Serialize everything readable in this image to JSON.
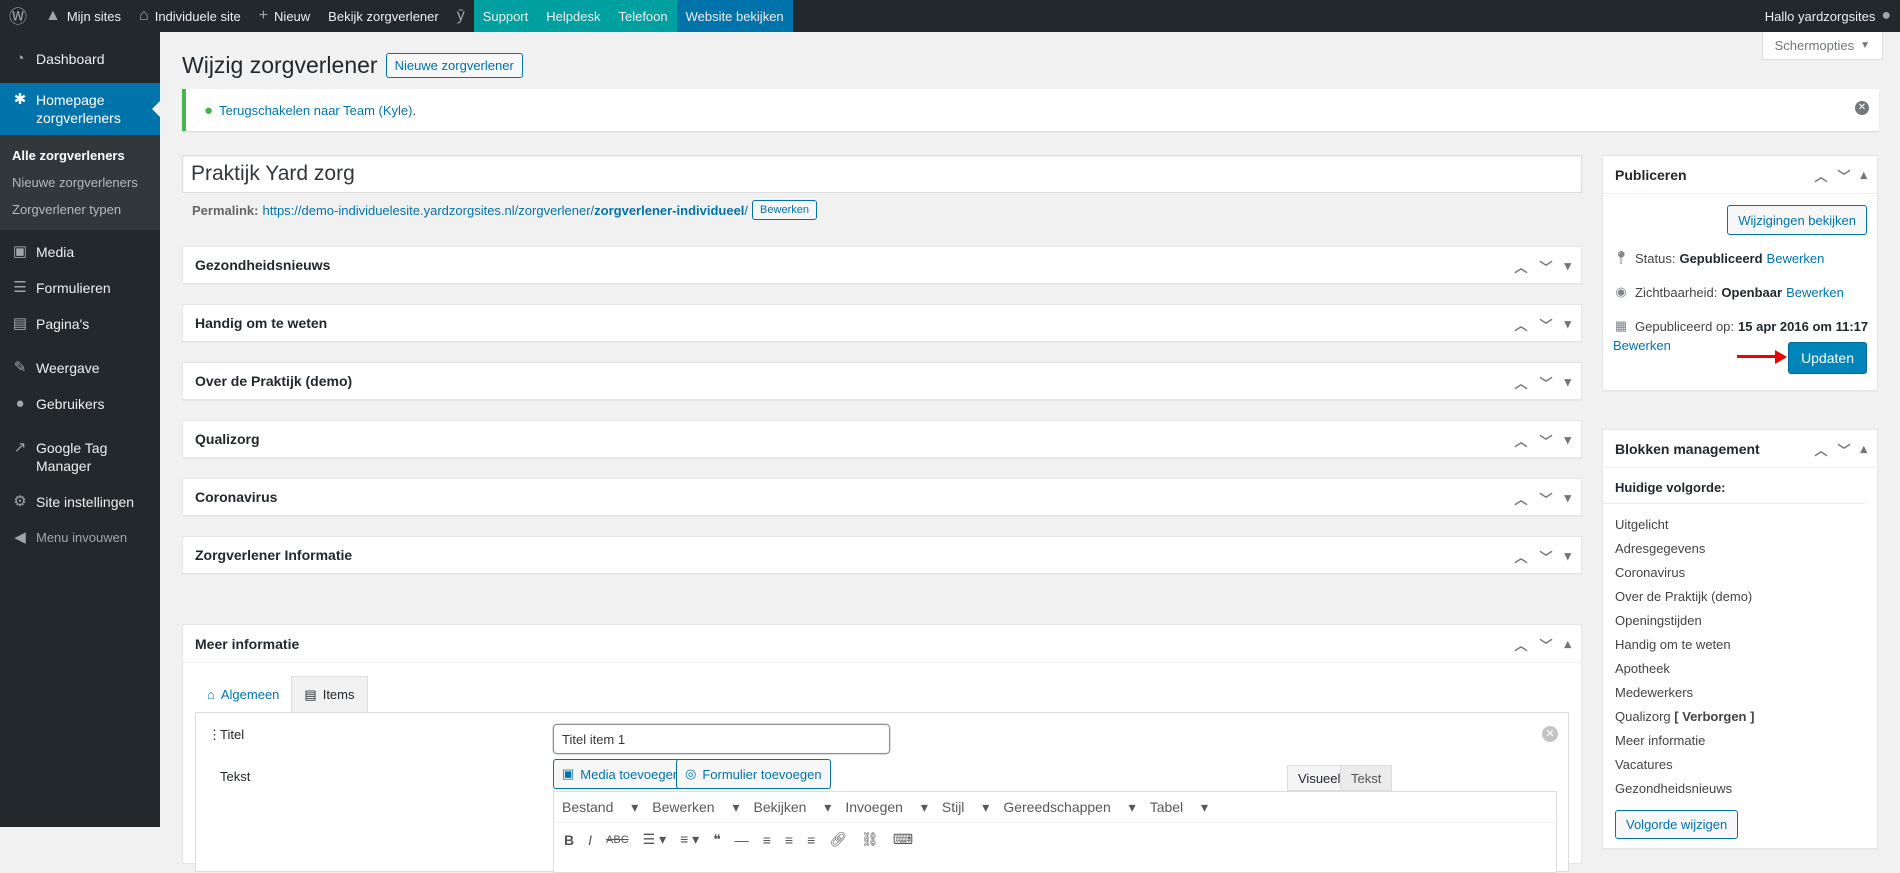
{
  "adminbar": {
    "mijn_sites": "Mijn sites",
    "individuele_site": "Individuele site",
    "nieuw": "Nieuw",
    "bekijk": "Bekijk zorgverlener",
    "support": "Support",
    "helpdesk": "Helpdesk",
    "telefoon": "Telefoon",
    "website_bekijken": "Website bekijken",
    "greeting": "Hallo yardzorgsites"
  },
  "sidebar": {
    "dashboard": "Dashboard",
    "homepage_line1": "Homepage",
    "homepage_line2": "zorgverleners",
    "sub": [
      "Alle zorgverleners",
      "Nieuwe zorgverleners",
      "Zorgverlener typen"
    ],
    "media": "Media",
    "formulieren": "Formulieren",
    "paginas": "Pagina's",
    "weergave": "Weergave",
    "gebruikers": "Gebruikers",
    "gtm_line1": "Google Tag",
    "gtm_line2": "Manager",
    "site_instellingen": "Site instellingen",
    "menu_invouwen": "Menu invouwen"
  },
  "screen_options": "Schermopties",
  "page": {
    "title": "Wijzig zorgverlener",
    "new_button": "Nieuwe zorgverlener",
    "notice_link": "Terugschakelen naar Team (Kyle)",
    "notice_suffix": ".",
    "post_title": "Praktijk Yard zorg",
    "permalink_label": "Permalink:",
    "permalink_base": "https://demo-individuelesite.yardzorgsites.nl/zorgverlener/",
    "permalink_slug": "zorgverlener-individueel",
    "permalink_tail": "/",
    "permalink_edit": "Bewerken"
  },
  "postboxes": [
    "Gezondheidsnieuws",
    "Handig om te weten",
    "Over de Praktijk (demo)",
    "Qualizorg",
    "Coronavirus",
    "Zorgverlener Informatie"
  ],
  "meer": {
    "title": "Meer informatie",
    "tab_algemeen": "Algemeen",
    "tab_items": "Items",
    "titel_label": "Titel",
    "titel_value": "Titel item 1",
    "tekst_label": "Tekst",
    "media_btn": "Media toevoegen",
    "formulier_btn": "Formulier toevoegen",
    "visueel": "Visueel",
    "tekst_tab": "Tekst",
    "menus": [
      "Bestand",
      "Bewerken",
      "Bekijken",
      "Invoegen",
      "Stijl",
      "Gereedschappen",
      "Tabel"
    ]
  },
  "publish": {
    "title": "Publiceren",
    "preview_btn": "Wijzigingen bekijken",
    "status_label": "Status:",
    "status_value": "Gepubliceerd",
    "visibility_label": "Zichtbaarheid:",
    "visibility_value": "Openbaar",
    "published_label": "Gepubliceerd op:",
    "published_value": "15 apr 2016 om 11:17",
    "edit": "Bewerken",
    "update_btn": "Updaten"
  },
  "blokken": {
    "title": "Blokken management",
    "subtitle": "Huidige volgorde:",
    "items": [
      "Uitgelicht",
      "Adresgegevens",
      "Coronavirus",
      "Over de Praktijk (demo)",
      "Openingstijden",
      "Handig om te weten",
      "Apotheek",
      "Medewerkers",
      "Qualizorg",
      "Meer informatie",
      "Vacatures",
      "Gezondheidsnieuws"
    ],
    "qualizorg_tag": "[ Verborgen ]",
    "change_btn": "Volgorde wijzigen"
  },
  "colors": {
    "adminbar": "#23282d",
    "accent": "#0073aa",
    "support_green": "#00a0a0",
    "notice_green": "#46b450",
    "arrow_red": "#ee0000"
  }
}
